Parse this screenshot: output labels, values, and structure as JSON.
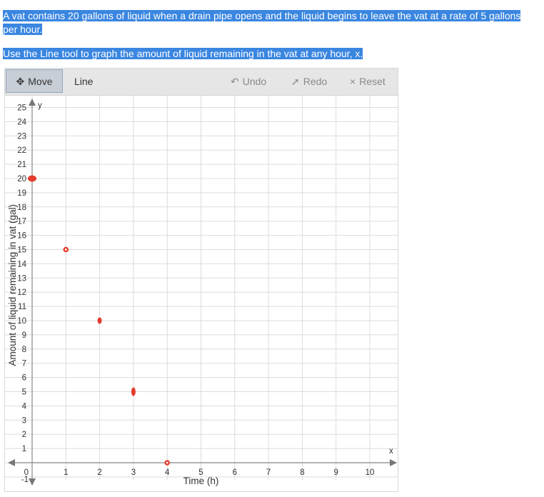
{
  "question": {
    "line1": "A vat contains 20 gallons of liquid when a drain pipe opens and the liquid begins to leave the vat at a rate of 5 gallons per hour.",
    "line2": "Use the Line tool to graph the amount of liquid remaining in the vat at any hour, x."
  },
  "toolbar": {
    "move_label": "Move",
    "line_label": "Line",
    "undo_label": "Undo",
    "redo_label": "Redo",
    "reset_label": "Reset"
  },
  "icons": {
    "move": "move-arrows-icon",
    "undo": "undo-arrow-icon",
    "redo": "redo-arrow-icon",
    "reset": "x-icon"
  },
  "colors": {
    "point": "#e53b2c",
    "highlight": "#3a86e0"
  },
  "chart_data": {
    "type": "scatter",
    "title": "",
    "xlabel": "Time (h)",
    "ylabel": "Amount of liquid remaining in vat (gal)",
    "x_axis_name": "x",
    "y_axis_name": "y",
    "xlim": [
      -1,
      10
    ],
    "ylim": [
      -1,
      25
    ],
    "x_ticks": [
      "1",
      "2",
      "3",
      "4",
      "5",
      "6",
      "7",
      "8",
      "9",
      "10"
    ],
    "y_ticks": [
      "1",
      "2",
      "3",
      "4",
      "5",
      "6",
      "7",
      "8",
      "9",
      "10",
      "11",
      "12",
      "13",
      "14",
      "15",
      "16",
      "17",
      "18",
      "19",
      "20",
      "21",
      "22",
      "23",
      "24",
      "25"
    ],
    "origin_label": "0",
    "neg_label": "-1",
    "grid": true,
    "points": [
      {
        "x": 0,
        "y": 20
      },
      {
        "x": 1,
        "y": 15
      },
      {
        "x": 2,
        "y": 10
      },
      {
        "x": 3,
        "y": 5
      },
      {
        "x": 4,
        "y": 0
      }
    ]
  }
}
